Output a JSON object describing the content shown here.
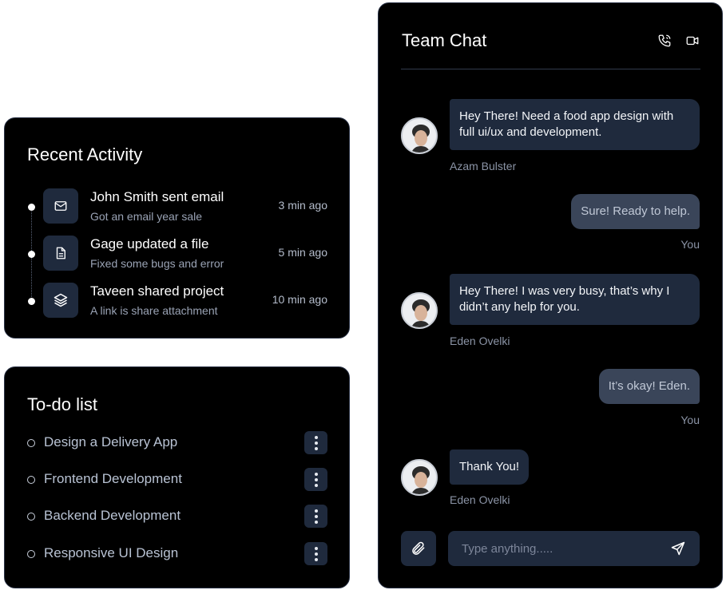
{
  "recent_activity": {
    "title": "Recent Activity",
    "items": [
      {
        "icon": "mail-icon",
        "title": "John Smith sent email",
        "subtitle": "Got an email year sale",
        "time": "3 min ago"
      },
      {
        "icon": "file-icon",
        "title": "Gage updated a file",
        "subtitle": "Fixed some bugs and error",
        "time": "5 min ago"
      },
      {
        "icon": "layers-icon",
        "title": "Taveen shared project",
        "subtitle": "A link is share attachment",
        "time": "10 min ago"
      }
    ]
  },
  "todo": {
    "title": "To-do list",
    "items": [
      {
        "label": "Design a Delivery App"
      },
      {
        "label": "Frontend Development"
      },
      {
        "label": "Backend Development"
      },
      {
        "label": "Responsive UI Design"
      }
    ]
  },
  "chat": {
    "title": "Team Chat",
    "header_icons": [
      "phone-icon",
      "video-icon"
    ],
    "messages": [
      {
        "direction": "in",
        "text": "Hey There! Need a food app design with full ui/ux and development.",
        "sender": "Azam Bulster"
      },
      {
        "direction": "out",
        "text": "Sure! Ready to help.",
        "sender": "You"
      },
      {
        "direction": "in",
        "text": "Hey There! I was very busy, that’s why I didn’t any help for you.",
        "sender": "Eden Ovelki"
      },
      {
        "direction": "out",
        "text": "It’s okay! Eden.",
        "sender": "You"
      },
      {
        "direction": "in",
        "text": "Thank You!",
        "sender": "Eden Ovelki"
      }
    ],
    "input": {
      "placeholder": "Type anything....."
    },
    "attach_icon": "paperclip-icon",
    "send_icon": "send-icon"
  },
  "colors": {
    "card_bg": "#000000",
    "card_border": "#2a3347",
    "tile_bg": "#1f2a3d",
    "outgoing_bubble": "#3a4559",
    "muted_text": "#9aa3b5"
  }
}
